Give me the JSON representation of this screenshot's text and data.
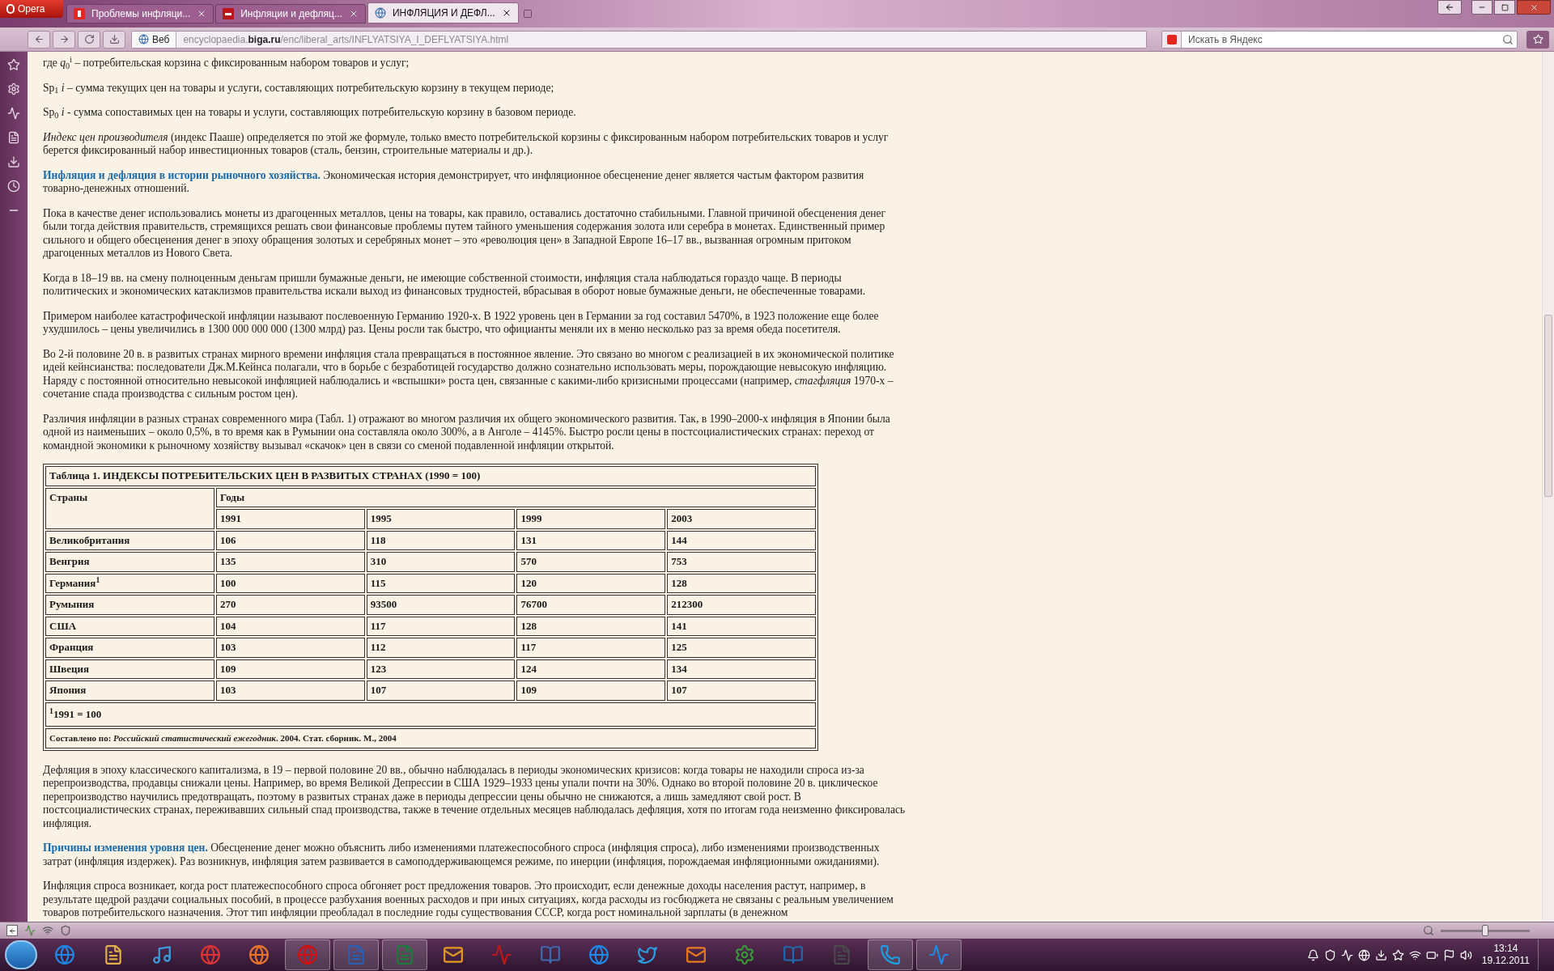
{
  "browser": {
    "opera_button": "Opera",
    "tabs": [
      {
        "label": "Проблемы инфляци...",
        "selected": false,
        "kind": "yandex"
      },
      {
        "label": "Инфляции и дефляц...",
        "selected": false,
        "kind": "letter"
      },
      {
        "label": "ИНФЛЯЦИЯ И ДЕФЛ...",
        "selected": true,
        "kind": "globe"
      }
    ],
    "address": {
      "badge": "Веб",
      "url": "encyclopaedia.**biga.ru**/enc/liberal_arts/INFLYATSIYA_I_DEFLYATSIYA.html"
    },
    "search": {
      "placeholder": "Искать в Яндекс"
    }
  },
  "article": {
    "blocks": [
      {
        "kind": "paragraph",
        "text": "где *q*$_{0}$$^{i}$ – потребительская корзина с фиксированным набором товаров и услуг;"
      },
      {
        "kind": "paragraph",
        "text": "Sp$_{1}$ *i* – сумма текущих цен на товары и услуги, составляющих потребительскую корзину в текущем периоде;"
      },
      {
        "kind": "paragraph",
        "text": "Sp$_{0}$ *i* - сумма сопоставимых цен на товары и услуги, составляющих потребительскую корзину в базовом периоде."
      },
      {
        "kind": "paragraph",
        "text": "*Индекс цен производителя* (индекс Пааше) определяется по этой же формуле, только вместо потребительской корзины с фиксированным набором потребительских товаров и услуг берется фиксированный набор инвестиционных товаров (сталь, бензин, строительные материалы и др.)."
      },
      {
        "kind": "paragraph",
        "text": "**Инфляция и дефляция в истории рыночного хозяйства.** Экономическая история демонстрирует, что инфляционное обесценение денег является частым фактором развития товарно-денежных отношений."
      },
      {
        "kind": "paragraph",
        "text": "Пока в качестве денег использовались монеты из драгоценных металлов, цены на товары, как правило, оставались достаточно стабильными. Главной причиной обесценения денег были тогда действия правительств, стремящихся решать свои финансовые проблемы путем тайного уменьшения содержания золота или серебра в монетах. Единственный пример сильного и общего обесценения денег в эпоху обращения золотых и серебряных монет – это «революция цен» в Западной Европе 16–17 вв., вызванная огромным притоком драгоценных металлов из Нового Света."
      },
      {
        "kind": "paragraph",
        "text": "Когда в 18–19 вв. на смену полноценным деньгам пришли бумажные деньги, не имеющие собственной стоимости, инфляция стала наблюдаться гораздо чаще. В периоды политических и экономических катаклизмов правительства искали выход из финансовых трудностей, вбрасывая в оборот новые бумажные деньги, не обеспеченные товарами."
      },
      {
        "kind": "paragraph",
        "text": "Примером наиболее катастрофической инфляции называют послевоенную Германию 1920-х. В 1922 уровень цен в Германии за год составил 5470%, в 1923 положение еще более ухудшилось – цены увеличились в 1300 000 000 000 (1300 млрд) раз. Цены росли так быстро, что официанты меняли их в меню несколько раз за время обеда посетителя."
      },
      {
        "kind": "paragraph",
        "text": "Во 2-й половине 20 в. в развитых странах мирного времени инфляция стала превращаться в постоянное явление. Это связано во многом с реализацией в их экономической политике идей кейнсианства: последователи Дж.М.Кейнса полагали, что в борьбе с безработицей государство должно сознательно использовать меры, порождающие невысокую инфляцию. Наряду с постоянной относительно невысокой инфляцией наблюдались и «вспышки» роста цен, связанные с какими-либо кризисными процессами (например, *стагфляция* 1970-х – сочетание спада производства с сильным ростом цен)."
      },
      {
        "kind": "paragraph",
        "text": "Различия инфляции в разных странах современного мира (Табл. 1) отражают во многом различия их общего экономического развития. Так, в 1990–2000-х инфляция в Японии была одной из наименьших – около 0,5%, в то время как в Румынии она составляла около 300%, а в Анголе – 4145%. Быстро росли цены в постсоциалистических странах: переход от командной экономики к рыночному хозяйству вызывал «скачок» цен в связи со сменой подавленной инфляции открытой."
      },
      {
        "kind": "table",
        "caption": "Таблица 1. ИНДЕКСЫ ПОТРЕБИТЕЛЬСКИХ ЦЕН В РАЗВИТЫХ СТРАНАХ (1990 = 100)",
        "first_header": "Страны",
        "group_header": "Годы",
        "years": [
          "1991",
          "1995",
          "1999",
          "2003"
        ],
        "rows": [
          {
            "country": "Великобритания",
            "values": [
              "106",
              "118",
              "131",
              "144"
            ]
          },
          {
            "country": "Венгрия",
            "values": [
              "135",
              "310",
              "570",
              "753"
            ]
          },
          {
            "country": "Германия$^{1}$",
            "values": [
              "100",
              "115",
              "120",
              "128"
            ]
          },
          {
            "country": "Румыния",
            "values": [
              "270",
              "93500",
              "76700",
              "212300"
            ]
          },
          {
            "country": "США",
            "values": [
              "104",
              "117",
              "128",
              "141"
            ]
          },
          {
            "country": "Франция",
            "values": [
              "103",
              "112",
              "117",
              "125"
            ]
          },
          {
            "country": "Швеция",
            "values": [
              "109",
              "123",
              "124",
              "134"
            ]
          },
          {
            "country": "Япония",
            "values": [
              "103",
              "107",
              "109",
              "107"
            ]
          }
        ],
        "footnote": "$^{1}$1991 = 100",
        "source": "Составлено по: *Российский статистический ежегодник*. 2004. Стат. сборник. М., 2004"
      },
      {
        "kind": "paragraph",
        "text": "Дефляция в эпоху классического капитализма, в 19 – первой половине 20 вв., обычно наблюдалась в периоды экономических кризисов: когда товары не находили спроса из-за перепроизводства, продавцы снижали цены. Например, во время Великой Депрессии в США 1929–1933 цены упали почти на 30%. Однако во второй половине 20 в. циклическое перепроизводство научились предотвращать, поэтому в развитых странах даже в периоды депрессии цены обычно не снижаются, а лишь замедляют свой рост. В постсоциалистических странах, переживавших сильный спад производства, также в течение отдельных месяцев наблюдалась дефляция, хотя по итогам года неизменно фиксировалась инфляция."
      },
      {
        "kind": "paragraph",
        "text": "**Причины изменения уровня цен.** Обесценение денег можно объяснить либо изменениями платежеспособного спроса (инфляция спроса), либо изменениями производственных затрат (инфляция издержек). Раз возникнув, инфляция затем развивается в самоподдерживающемся режиме, по инерции (инфляция, порождаемая инфляционными ожиданиями)."
      },
      {
        "kind": "paragraph",
        "text": "Инфляция спроса возникает, когда рост платежеспособного спроса обгоняет рост предложения товаров. Это происходит, если денежные доходы населения растут, например, в результате щедрой раздачи социальных пособий, в процессе разбухания военных расходов и при иных ситуациях, когда расходы из госбюджета не связаны с реальным увеличением товаров потребительского назначения. Этот тип инфляции преобладал в последние годы существования СССР, когда рост номинальной зарплаты (в денежном"
      }
    ]
  },
  "status_bar": {
    "zoom_slider": {
      "level": 0.5
    }
  },
  "taskbar": {
    "time": "13:14",
    "date": "19.12.2011"
  }
}
